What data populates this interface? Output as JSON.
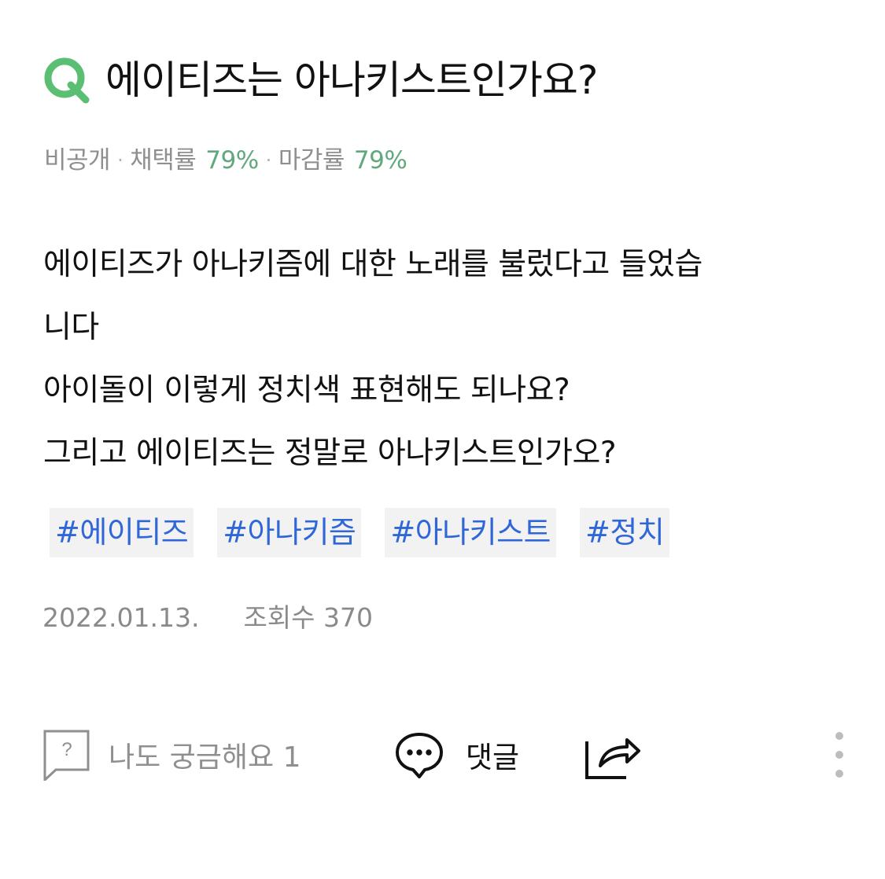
{
  "question": {
    "title": "에이티즈는 아나키스트인가요?",
    "meta": {
      "visibility": "비공개",
      "adoption_label": "채택률",
      "adoption_rate": "79%",
      "closing_label": "마감률",
      "closing_rate": "79%"
    },
    "body_lines": [
      "에이티즈가 아나키즘에 대한 노래를 불렀다고 들었습",
      "니다",
      "아이돌이 이렇게 정치색 표현해도 되나요?",
      "그리고 에이티즈는 정말로 아나키스트인가오?"
    ],
    "tags": [
      "#에이티즈",
      "#아나키즘",
      "#아나키스트",
      "#정치"
    ],
    "date": "2022.01.13.",
    "views": "조회수 370"
  },
  "actions": {
    "curious": "나도 궁금해요 1",
    "comment": "댓글"
  },
  "icons": {
    "question_mark": "q-icon",
    "curious": "question-bubble-icon",
    "comment": "chat-bubble-icon",
    "share": "share-icon",
    "more": "vertical-dots-icon"
  },
  "colors": {
    "brand_green": "#5bbf73",
    "rate_green": "#62a87f",
    "tag_blue": "#2f67d8",
    "meta_gray": "#8f8f8f",
    "tag_background": "#f2f2f2"
  }
}
